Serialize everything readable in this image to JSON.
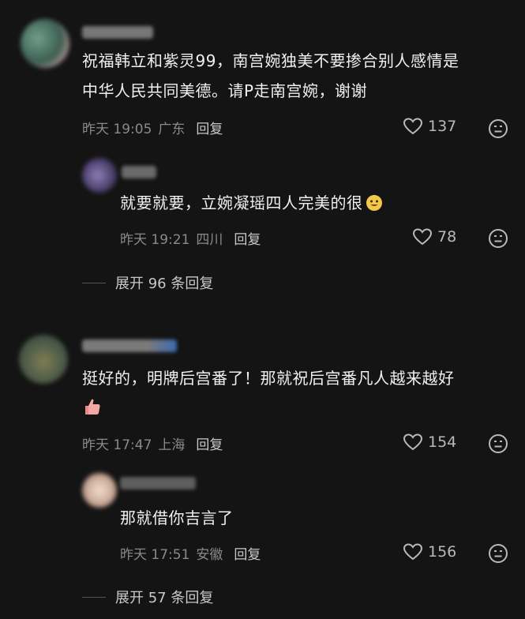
{
  "comments": [
    {
      "text": "祝福韩立和紫灵99，南宫婉独美不要掺合别人感情是中华人民共同美德。请P走南宫婉，谢谢",
      "line1": "祝福韩立和紫灵99，南宫婉独美不要掺合别人感情是",
      "line2": "中华人民共同美德。请P走南宫婉，谢谢",
      "time": "昨天 19:05",
      "location": "广东",
      "reply_label": "回复",
      "likes": "137",
      "replies": [
        {
          "text": "就要就要，立婉凝瑶四人完美的很",
          "emoji": "smiling-face-emoji",
          "time": "昨天 19:21",
          "location": "四川",
          "reply_label": "回复",
          "likes": "78"
        }
      ],
      "expand_label": "展开 96 条回复"
    },
    {
      "text": "挺好的，明牌后宫番了！那就祝后宫番凡人越来越好",
      "line1": "挺好的，明牌后宫番了！那就祝后宫番凡人越来越好",
      "emoji": "thumbs-up-emoji",
      "time": "昨天 17:47",
      "location": "上海",
      "reply_label": "回复",
      "likes": "154",
      "replies": [
        {
          "text": "那就借你吉言了",
          "time": "昨天 17:51",
          "location": "安徽",
          "reply_label": "回复",
          "likes": "156"
        }
      ],
      "expand_label": "展开 57 条回复"
    }
  ],
  "colors": {
    "background": "#141414",
    "text": "#f0f0f0",
    "meta": "#8a8a8a",
    "like": "#b9b9b9"
  }
}
